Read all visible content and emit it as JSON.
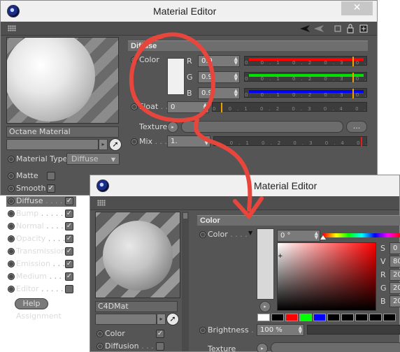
{
  "win1": {
    "title": "Material Editor",
    "close_glyph": "✕",
    "material_name": "Octane Material",
    "material_type_label": "Material Type",
    "material_type_value": "Diffuse",
    "channels": [
      {
        "label": "Matte",
        "dots": "",
        "checked": false
      },
      {
        "label": "Smooth",
        "dots": "",
        "checked": true
      },
      {
        "label": "Diffuse",
        "dots": " . . . . .",
        "checked": true
      },
      {
        "label": "Bump",
        "dots": " . . . . . .",
        "checked": true
      },
      {
        "label": "Normal",
        "dots": " . . . . .",
        "checked": true
      },
      {
        "label": "Opacity",
        "dots": " . . . .",
        "checked": true
      },
      {
        "label": "Transmission",
        "dots": "",
        "checked": true
      },
      {
        "label": "Emission",
        "dots": " . . .",
        "checked": true
      },
      {
        "label": "Medium",
        "dots": " . . . .",
        "checked": true
      },
      {
        "label": "Editor",
        "dots": " . . . . .",
        "checked": false
      }
    ],
    "help_label": "Help",
    "assignment_label": "Assignment",
    "section_title": "Diffuse",
    "color_label": "Color",
    "rgb": [
      {
        "label": "R",
        "value": "0.9",
        "fraction": 0.9,
        "color": "#ff0000"
      },
      {
        "label": "G",
        "value": "0.9",
        "fraction": 0.9,
        "color": "#00e000"
      },
      {
        "label": "B",
        "value": "0.9",
        "fraction": 0.9,
        "color": "#0000ff"
      }
    ],
    "float_label": "Float",
    "float_dots": " . .",
    "float_value": "0",
    "texture_label": "Texture",
    "texture_button": "...",
    "mix_label": "Mix",
    "mix_dots": " . . .",
    "mix_value": "1.",
    "ticks": "0 0.1 0.2 0.3 0.4 0.5 0.6 0.7 0.8 0.9 1"
  },
  "win2": {
    "title": "Material Editor",
    "material_name": "C4DMat",
    "section_title": "Color",
    "color_label": "Color",
    "color_dots": " . . . .",
    "hue_value": "0 °",
    "channels": [
      {
        "label": "Color",
        "dots": "",
        "checked": true
      },
      {
        "label": "Diffusion",
        "dots": " . . .",
        "checked": false
      }
    ],
    "brightness_label": "Brightness",
    "brightness_dots": " . .",
    "brightness_value": "100 %",
    "texture_label": "Texture",
    "hsv_rgb": [
      {
        "label": "S",
        "value": "0"
      },
      {
        "label": "V",
        "value": "80"
      },
      {
        "label": "R",
        "value": "20"
      },
      {
        "label": "G",
        "value": "20"
      },
      {
        "label": "B",
        "value": "20"
      }
    ],
    "palette": [
      "#ffffff",
      "#000000",
      "#ff0000",
      "#00ff00",
      "#0000ff",
      "#000000",
      "#000000",
      "#000000",
      "#000000",
      "#000000"
    ]
  },
  "colors": {
    "annotation_red": "#e8463c",
    "panel_bg": "#555555",
    "section_header": "#6e6e6e"
  }
}
